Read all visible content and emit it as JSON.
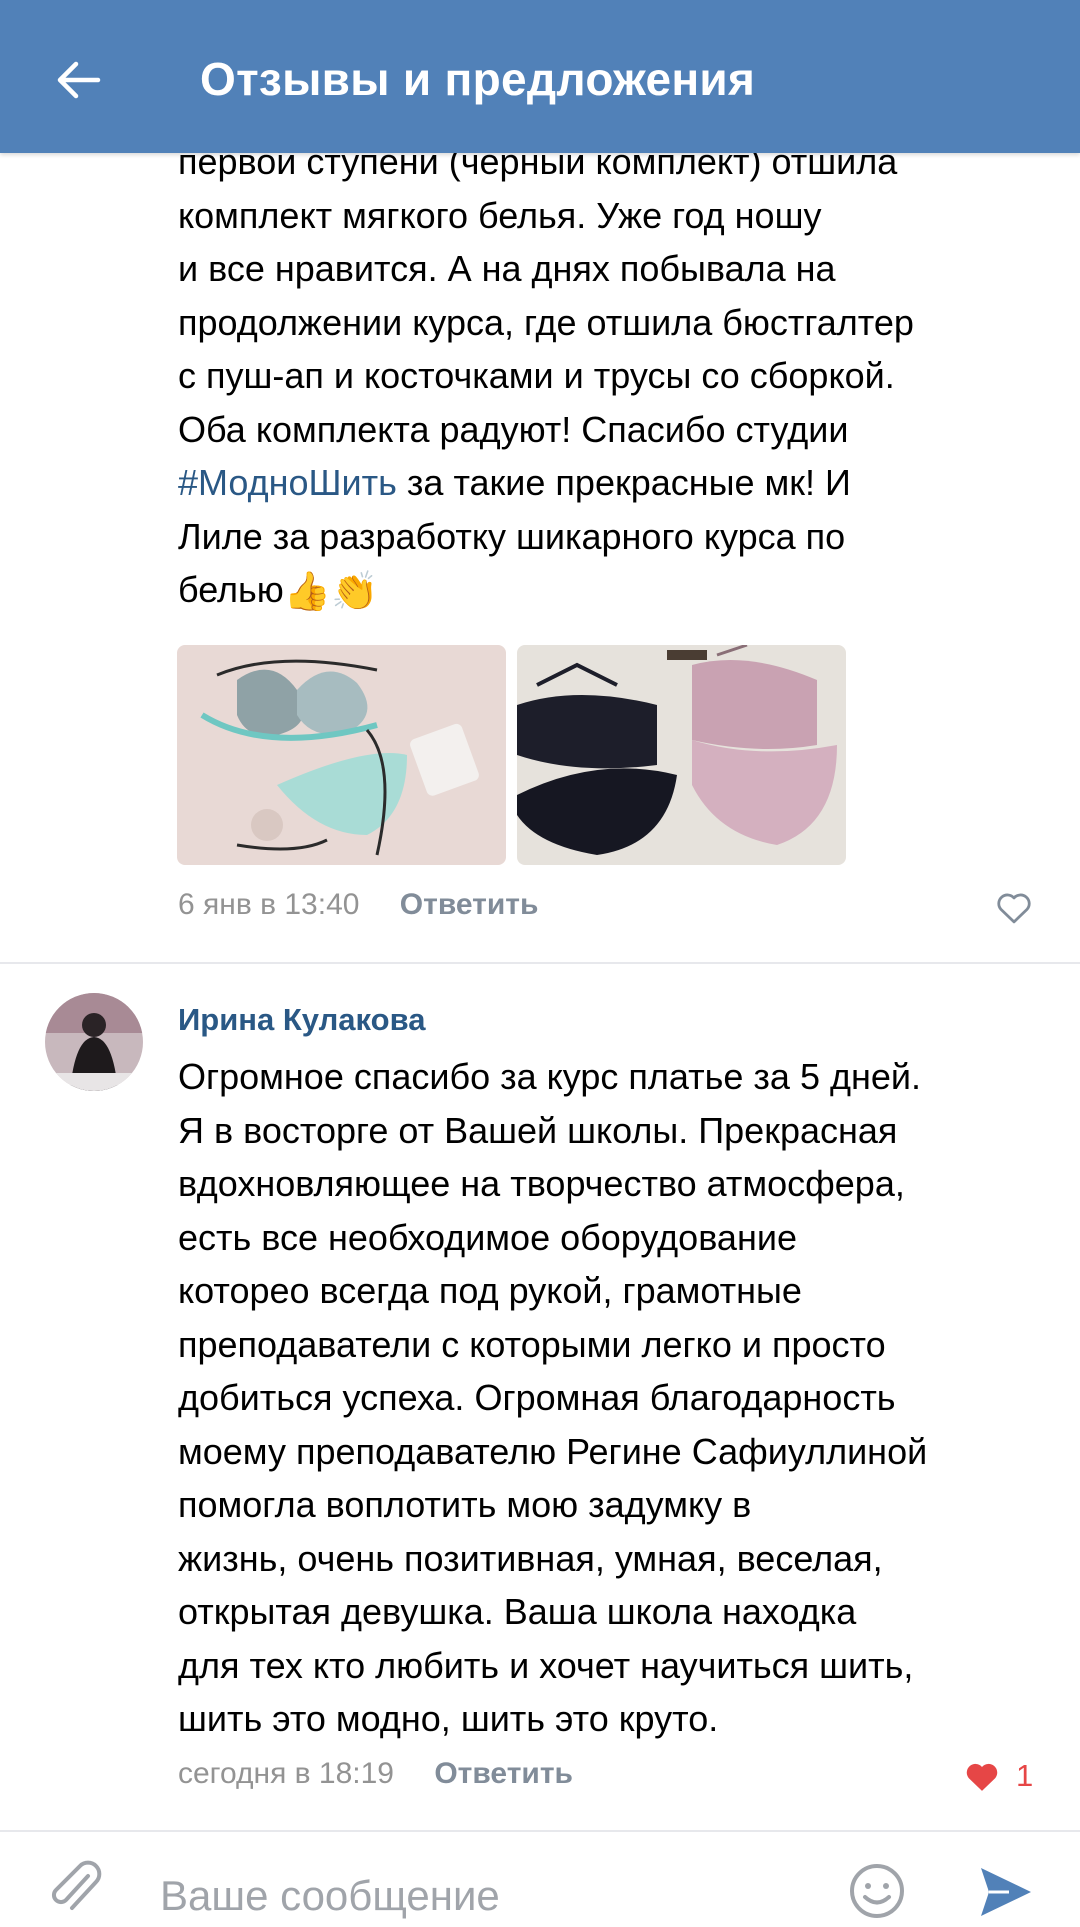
{
  "header": {
    "title": "Отзывы и предложения",
    "back_icon": "arrow-left-icon",
    "color": "#5181b8"
  },
  "post": {
    "text_lines": [
      "первой ступени (черный комплект) отшила",
      "комплект мягкого белья. Уже год ношу",
      "и все нравится. А на днях побывала на",
      "продолжении курса, где отшила бюстгалтер",
      "с пуш-ап и косточками и трусы со сборкой.",
      "Оба комплекта радуют! Спасибо студии"
    ],
    "hashtag": "#МодноШить",
    "after_hashtag": " за такие прекрасные мк! И",
    "line_8": "Лиле за разработку шикарного курса по",
    "line_9": "белью",
    "emoji_1": "👍",
    "emoji_2": "👏",
    "photos": [
      "mint-lace-lingerie-photo",
      "black-and-pink-lingerie-photo"
    ],
    "date": "6 янв в 13:40",
    "reply_label": "Ответить"
  },
  "comment": {
    "author": "Ирина Кулакова",
    "text_lines": [
      "Огромное спасибо за курс платье за 5 дней.",
      "Я в восторге от Вашей школы. Прекрасная",
      "вдохновляющее на творчество атмосфера,",
      "есть все необходимое оборудование",
      "котореo всегда под рукой, грамотные",
      "преподаватели с которыми легко и просто",
      "добиться успеха. Огромная благодарность",
      "моему преподавателю Регине Сафиуллиной",
      "помогла воплотить мою задумку в",
      "жизнь, очень позитивная, умная, веселая,",
      "открытая девушка. Ваша школа находка",
      "для тех кто любить и хочет научиться шить,",
      "шить это модно, шить это круто."
    ],
    "date": "сегодня в 18:19",
    "reply_label": "Ответить",
    "likes": "1",
    "liked_color": "#e64646"
  },
  "composer": {
    "placeholder": "Ваше сообщение",
    "attach_icon": "paperclip-icon",
    "emoji_icon": "smiley-icon",
    "send_icon": "send-icon"
  }
}
